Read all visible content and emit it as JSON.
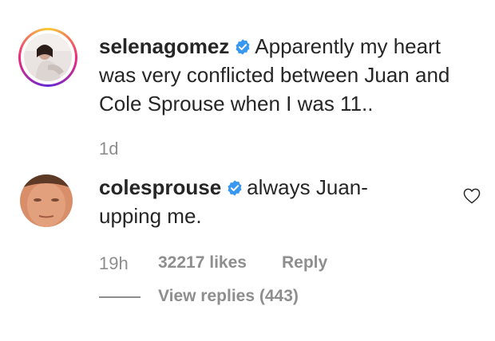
{
  "comments": [
    {
      "username": "selenagomez",
      "text": "Apparently my heart was very conflicted between Juan and Cole Sprouse when I was 11..",
      "time": "1d"
    },
    {
      "username": "colesprouse",
      "text": "always Juan-upping me.",
      "time": "19h",
      "likes": "32217 likes",
      "reply_label": "Reply",
      "view_replies": "View replies (443)"
    }
  ],
  "colors": {
    "text": "#262626",
    "meta": "#8e8e8e",
    "verified": "#3897f0"
  },
  "icons": {
    "verified": "verified-badge-icon",
    "like": "heart-outline-icon"
  }
}
